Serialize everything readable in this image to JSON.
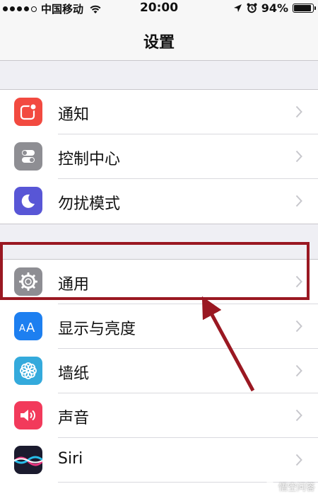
{
  "status_bar": {
    "carrier": "中国移动",
    "time": "20:00",
    "battery_percent_label": "94%",
    "battery_level": 0.94
  },
  "nav": {
    "title": "设置"
  },
  "groups": [
    {
      "items": [
        {
          "label": "通知",
          "icon": "notifications-icon",
          "color": "#f24a40"
        },
        {
          "label": "控制中心",
          "icon": "control-center-icon",
          "color": "#8e8e93"
        },
        {
          "label": "勿扰模式",
          "icon": "do-not-disturb-icon",
          "color": "#5856d6"
        }
      ]
    },
    {
      "items": [
        {
          "label": "通用",
          "icon": "gear-icon",
          "color": "#8e8e93"
        },
        {
          "label": "显示与亮度",
          "icon": "display-brightness-icon",
          "color": "#1d7ff0"
        },
        {
          "label": "墙纸",
          "icon": "wallpaper-icon",
          "color": "#34aadc"
        },
        {
          "label": "声音",
          "icon": "sounds-icon",
          "color": "#f23a5b"
        },
        {
          "label": "Siri",
          "icon": "siri-icon",
          "color": "#1b1b2e"
        }
      ]
    }
  ],
  "annotation": {
    "highlight_color": "#9a1822"
  },
  "watermark": {
    "text": "悟空问答"
  }
}
